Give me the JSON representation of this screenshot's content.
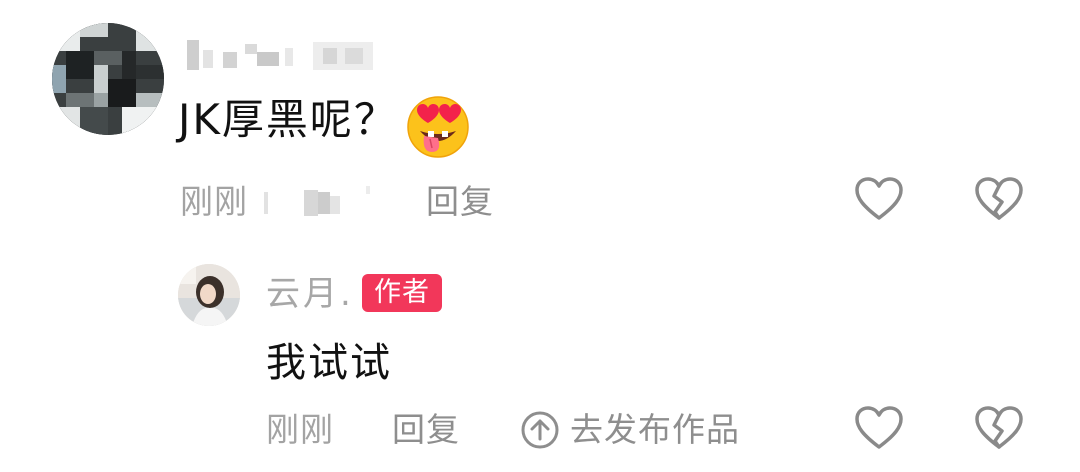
{
  "colors": {
    "text_primary": "#111111",
    "text_meta": "#a3a3a3",
    "author_badge_bg": "#f2375a",
    "author_badge_text": "#ffffff",
    "icon_stroke": "#8a8a8a"
  },
  "comment": {
    "avatar": "pixelated-avatar",
    "username_obscured": true,
    "text": "JK厚黑呢？",
    "emoji": "heart-eyes-tongue-emoji",
    "time": "刚刚",
    "location_obscured": true,
    "reply_label": "回复",
    "like_icon": "heart-outline-icon",
    "dislike_icon": "broken-heart-icon"
  },
  "reply": {
    "avatar": "user-photo-avatar",
    "username": "云月.",
    "author_badge": "作者",
    "text": "我试试",
    "time": "刚刚",
    "reply_label": "回复",
    "publish_icon": "arrow-up-circle-icon",
    "publish_label": "去发布作品",
    "like_icon": "heart-outline-icon",
    "dislike_icon": "broken-heart-icon"
  }
}
